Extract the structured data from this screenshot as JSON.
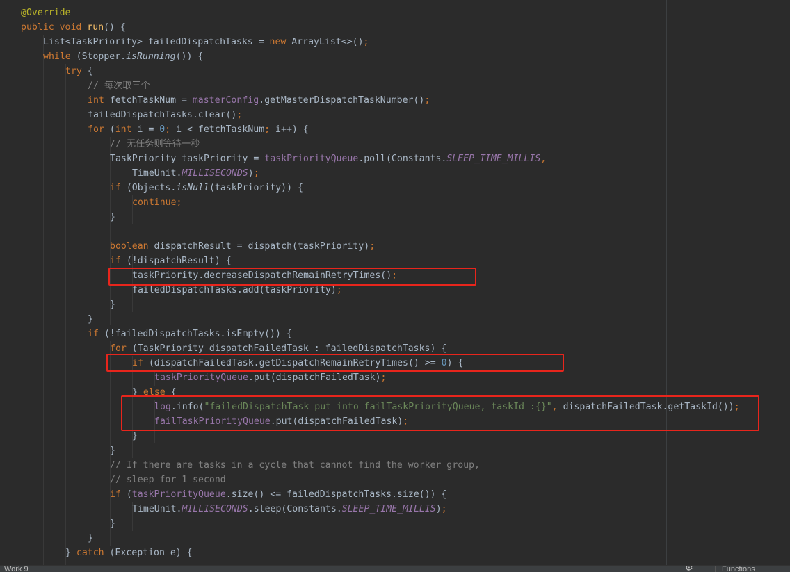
{
  "theme": {
    "background": "#2b2b2b",
    "default_text": "#a9b7c6",
    "keyword": "#cc7832",
    "annotation": "#bbb529",
    "field": "#9876aa",
    "comment": "#808080",
    "number": "#6897bb",
    "string": "#6a8759",
    "method_declaration": "#ffc66d",
    "highlight_box": "#e8251c"
  },
  "editor": {
    "lines": [
      [
        {
          "t": "@Override",
          "c": "ann"
        }
      ],
      [
        {
          "t": "public ",
          "c": "kw"
        },
        {
          "t": "void ",
          "c": "kw"
        },
        {
          "t": "run",
          "c": "fn"
        },
        {
          "t": "() {"
        }
      ],
      [
        {
          "t": "List<TaskPriority> failedDispatchTasks = "
        },
        {
          "t": "new ",
          "c": "kw"
        },
        {
          "t": "ArrayList<>()"
        },
        {
          "t": ";",
          "c": "kw"
        }
      ],
      [
        {
          "t": "while ",
          "c": "kw"
        },
        {
          "t": "(Stopper."
        },
        {
          "t": "isRunning",
          "c": "method-italic"
        },
        {
          "t": "()) {"
        }
      ],
      [
        {
          "t": "try ",
          "c": "kw"
        },
        {
          "t": "{"
        }
      ],
      [
        {
          "t": "// 每次取三个",
          "c": "cmt"
        }
      ],
      [
        {
          "t": "int ",
          "c": "kw"
        },
        {
          "t": "fetchTaskNum = "
        },
        {
          "t": "masterConfig",
          "c": "field"
        },
        {
          "t": ".getMasterDispatchTaskNumber()"
        },
        {
          "t": ";",
          "c": "kw"
        }
      ],
      [
        {
          "t": "failedDispatchTasks.clear()"
        },
        {
          "t": ";",
          "c": "kw"
        }
      ],
      [
        {
          "t": "for ",
          "c": "kw"
        },
        {
          "t": "("
        },
        {
          "t": "int ",
          "c": "kw"
        },
        {
          "t": "i",
          "c": "uvar"
        },
        {
          "t": " = "
        },
        {
          "t": "0",
          "c": "num"
        },
        {
          "t": "; ",
          "c": "kw"
        },
        {
          "t": "i",
          "c": "uvar"
        },
        {
          "t": " < fetchTaskNum"
        },
        {
          "t": "; ",
          "c": "kw"
        },
        {
          "t": "i",
          "c": "uvar"
        },
        {
          "t": "++) {"
        }
      ],
      [
        {
          "t": "// 无任务则等待一秒",
          "c": "cmt"
        }
      ],
      [
        {
          "t": "TaskPriority taskPriority = "
        },
        {
          "t": "taskPriorityQueue",
          "c": "field"
        },
        {
          "t": ".poll(Constants."
        },
        {
          "t": "SLEEP_TIME_MILLIS",
          "c": "static"
        },
        {
          "t": ",",
          "c": "kw"
        }
      ],
      [
        {
          "t": "TimeUnit."
        },
        {
          "t": "MILLISECONDS",
          "c": "static"
        },
        {
          "t": ")"
        },
        {
          "t": ";",
          "c": "kw"
        }
      ],
      [
        {
          "t": "if ",
          "c": "kw"
        },
        {
          "t": "(Objects."
        },
        {
          "t": "isNull",
          "c": "method-italic"
        },
        {
          "t": "(taskPriority)) {"
        }
      ],
      [
        {
          "t": "continue;",
          "c": "kw"
        }
      ],
      [
        {
          "t": "}"
        }
      ],
      [],
      [
        {
          "t": "boolean ",
          "c": "kw"
        },
        {
          "t": "dispatchResult = dispatch(taskPriority)"
        },
        {
          "t": ";",
          "c": "kw"
        }
      ],
      [
        {
          "t": "if ",
          "c": "kw"
        },
        {
          "t": "(!dispatchResult) {"
        }
      ],
      [
        {
          "t": "taskPriority.decreaseDispatchRemainRetryTimes()"
        },
        {
          "t": ";",
          "c": "kw"
        }
      ],
      [
        {
          "t": "failedDispatchTasks.add(taskPriority)"
        },
        {
          "t": ";",
          "c": "kw"
        }
      ],
      [
        {
          "t": "}"
        }
      ],
      [
        {
          "t": "}"
        }
      ],
      [
        {
          "t": "if ",
          "c": "kw"
        },
        {
          "t": "(!failedDispatchTasks.isEmpty()) {"
        }
      ],
      [
        {
          "t": "for ",
          "c": "kw"
        },
        {
          "t": "(TaskPriority dispatchFailedTask : failedDispatchTasks) {"
        }
      ],
      [
        {
          "t": "if ",
          "c": "kw"
        },
        {
          "t": "(dispatchFailedTask.getDispatchRemainRetryTimes() >= "
        },
        {
          "t": "0",
          "c": "num"
        },
        {
          "t": ") {"
        }
      ],
      [
        {
          "t": "taskPriorityQueue",
          "c": "field"
        },
        {
          "t": ".put(dispatchFailedTask)"
        },
        {
          "t": ";",
          "c": "kw"
        }
      ],
      [
        {
          "t": "} "
        },
        {
          "t": "else ",
          "c": "kw"
        },
        {
          "t": "{"
        }
      ],
      [
        {
          "t": "log",
          "c": "field"
        },
        {
          "t": ".info("
        },
        {
          "t": "\"failedDispatchTask put into failTaskPriorityQueue, taskId :{}\"",
          "c": "str"
        },
        {
          "t": ", ",
          "c": "kw"
        },
        {
          "t": "dispatchFailedTask.getTaskId())"
        },
        {
          "t": ";",
          "c": "kw"
        }
      ],
      [
        {
          "t": "failTaskPriorityQueue",
          "c": "field"
        },
        {
          "t": ".put(dispatchFailedTask)"
        },
        {
          "t": ";",
          "c": "kw"
        }
      ],
      [
        {
          "t": "}"
        }
      ],
      [
        {
          "t": "}"
        }
      ],
      [
        {
          "t": "// If there are tasks in a cycle that cannot find the worker group,",
          "c": "cmt"
        }
      ],
      [
        {
          "t": "// sleep for 1 second",
          "c": "cmt"
        }
      ],
      [
        {
          "t": "if ",
          "c": "kw"
        },
        {
          "t": "("
        },
        {
          "t": "taskPriorityQueue",
          "c": "field"
        },
        {
          "t": ".size() <= failedDispatchTasks.size()) {"
        }
      ],
      [
        {
          "t": "TimeUnit."
        },
        {
          "t": "MILLISECONDS",
          "c": "static"
        },
        {
          "t": ".sleep(Constants."
        },
        {
          "t": "SLEEP_TIME_MILLIS",
          "c": "static"
        },
        {
          "t": ")"
        },
        {
          "t": ";",
          "c": "kw"
        }
      ],
      [
        {
          "t": "}"
        }
      ],
      [
        {
          "t": "}"
        }
      ],
      [
        {
          "t": "} "
        },
        {
          "t": "catch ",
          "c": "kw"
        },
        {
          "t": "(Exception e) {"
        }
      ]
    ]
  },
  "status_bar": {
    "left_text": "Work 9",
    "gear_icon": "gear-icon",
    "right_text": "Functions"
  }
}
